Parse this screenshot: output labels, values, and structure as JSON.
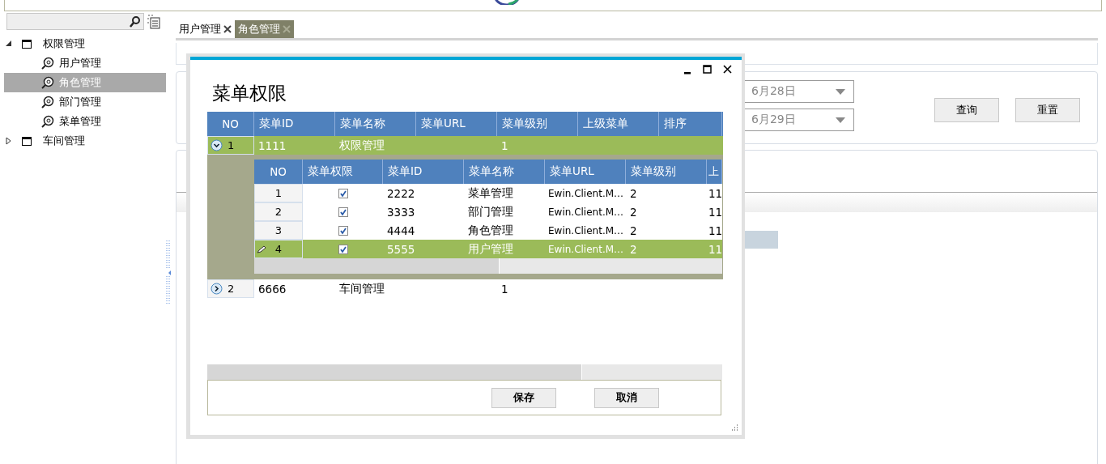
{
  "tree": [
    {
      "label": "权限管理",
      "expanded": true,
      "selected": false,
      "children": [
        {
          "label": "用户管理",
          "selected": false
        },
        {
          "label": "角色管理",
          "selected": true
        },
        {
          "label": "部门管理",
          "selected": false
        },
        {
          "label": "菜单管理",
          "selected": false
        }
      ]
    },
    {
      "label": "车间管理",
      "expanded": false,
      "selected": false
    }
  ],
  "tabs": [
    {
      "label": "用户管理",
      "selected": false
    },
    {
      "label": "角色管理",
      "selected": true
    }
  ],
  "filter": {
    "dates": [
      "6月28日",
      "6月29日"
    ],
    "buttons": [
      "查询",
      "重置"
    ]
  },
  "dialog": {
    "title": "菜单权限",
    "columns": [
      "NO",
      "菜单ID",
      "菜单名称",
      "菜单URL",
      "菜单级别",
      "上级菜单",
      "排序"
    ],
    "rows": [
      {
        "no": "1",
        "expanded": true,
        "selected": true,
        "id": "1111",
        "name": "权限管理",
        "level": "1",
        "detail": {
          "columns": [
            "NO",
            "菜单权限",
            "菜单ID",
            "菜单名称",
            "菜单URL",
            "菜单级别",
            "上"
          ],
          "rows": [
            {
              "no": "1",
              "checked": true,
              "selected": false,
              "id": "2222",
              "name": "菜单管理",
              "url": "Ewin.Client.M…",
              "level": "2",
              "column_7": "11"
            },
            {
              "no": "2",
              "checked": true,
              "selected": false,
              "id": "3333",
              "name": "部门管理",
              "url": "Ewin.Client.M…",
              "level": "2",
              "column_7": "11"
            },
            {
              "no": "3",
              "checked": true,
              "selected": false,
              "id": "4444",
              "name": "角色管理",
              "url": "Ewin.Client.M…",
              "level": "2",
              "column_7": "11"
            },
            {
              "no": "4",
              "checked": true,
              "selected": true,
              "id": "5555",
              "name": "用户管理",
              "url": "Ewin.Client.M…",
              "level": "2",
              "column_7": "11"
            }
          ]
        }
      },
      {
        "no": "2",
        "expanded": false,
        "selected": false,
        "id": "6666",
        "name": "车间管理",
        "level": "1"
      }
    ],
    "buttons": [
      "保存",
      "取消"
    ]
  }
}
